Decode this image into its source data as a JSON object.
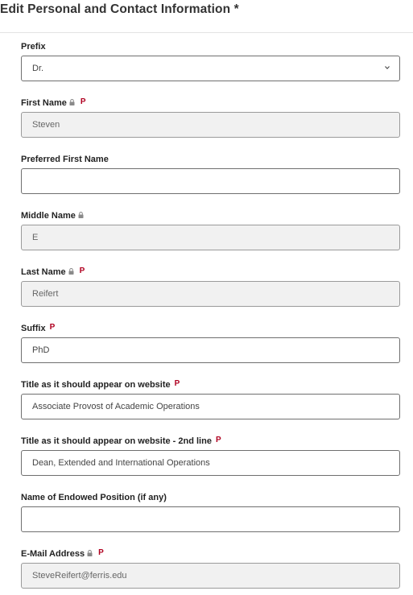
{
  "page": {
    "title": "Edit Personal and Contact Information *"
  },
  "icons": {
    "lock": "lock-icon",
    "chevron": "chevron-down-icon"
  },
  "colors": {
    "required_badge": "#b00020",
    "readonly_bg": "#f1f1f1",
    "border": "#6f6f6f"
  },
  "fields": {
    "prefix": {
      "label": "Prefix",
      "value": "Dr."
    },
    "first_name": {
      "label": "First Name",
      "badge": "P",
      "value": "Steven"
    },
    "preferred_first_name": {
      "label": "Preferred First Name",
      "value": ""
    },
    "middle_name": {
      "label": "Middle Name",
      "value": "E"
    },
    "last_name": {
      "label": "Last Name",
      "badge": "P",
      "value": "Reifert"
    },
    "suffix": {
      "label": "Suffix",
      "badge": "P",
      "value": "PhD"
    },
    "website_title": {
      "label": "Title as it should appear on website",
      "badge": "P",
      "value": "Associate Provost of Academic Operations"
    },
    "website_title_2": {
      "label": "Title as it should appear on website - 2nd line",
      "badge": "P",
      "value": "Dean, Extended and International Operations"
    },
    "endowed_position": {
      "label": "Name of Endowed Position (if any)",
      "value": ""
    },
    "email": {
      "label": "E-Mail Address",
      "badge": "P",
      "value": "SteveReifert@ferris.edu"
    }
  }
}
